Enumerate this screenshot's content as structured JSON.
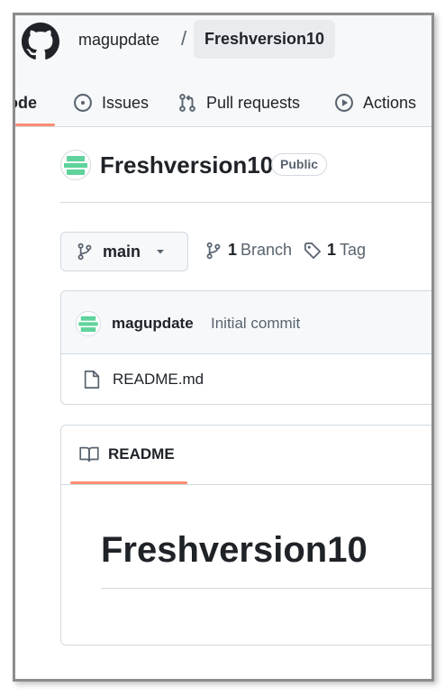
{
  "header": {
    "owner": "magupdate",
    "separator": "/",
    "repo": "Freshversion10"
  },
  "tabs": [
    {
      "label": "Code",
      "visible_text": "ode",
      "selected": true,
      "icon": "code-icon"
    },
    {
      "label": "Issues",
      "icon": "issue-opened-icon"
    },
    {
      "label": "Pull requests",
      "icon": "git-pull-request-icon"
    },
    {
      "label": "Actions",
      "icon": "play-icon"
    }
  ],
  "repo": {
    "title": "Freshversion10",
    "visibility": "Public"
  },
  "branch_bar": {
    "current_branch": "main",
    "branch_count": "1",
    "branch_label": "Branch",
    "tag_count": "1",
    "tag_label": "Tag"
  },
  "latest_commit": {
    "author": "magupdate",
    "message": "Initial commit"
  },
  "files": [
    {
      "name": "README.md",
      "icon": "file-icon"
    }
  ],
  "readme": {
    "tab_label": "README",
    "heading": "Freshversion10"
  },
  "colors": {
    "accent_underline": "#fd8c73",
    "avatar_green": "#5fd39b",
    "border": "#d1d9e0",
    "muted_text": "#59636e"
  }
}
